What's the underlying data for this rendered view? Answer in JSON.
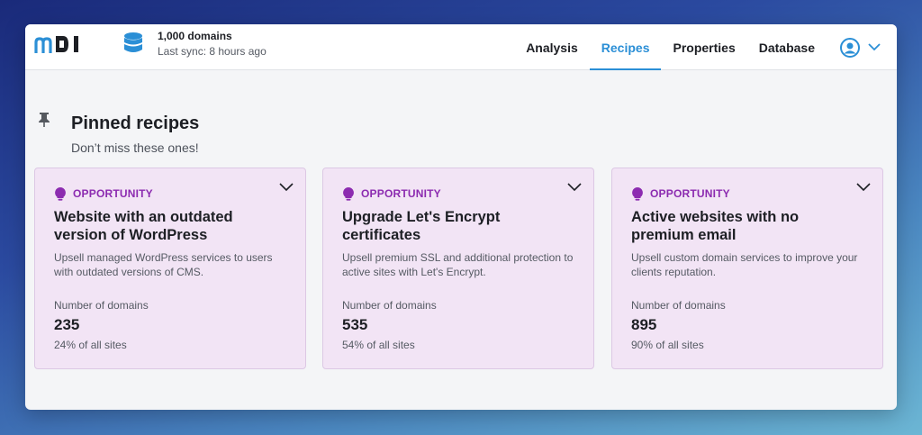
{
  "header": {
    "logo_text": "m01",
    "sync_title": "1,000 domains",
    "sync_subtitle": "Last sync: 8 hours ago",
    "nav": [
      {
        "label": "Analysis",
        "active": false
      },
      {
        "label": "Recipes",
        "active": true
      },
      {
        "label": "Properties",
        "active": false
      },
      {
        "label": "Database",
        "active": false
      }
    ],
    "accent_color": "#2b8fd6"
  },
  "pinned": {
    "title": "Pinned recipes",
    "subtitle": "Don’t miss these ones!"
  },
  "cards": [
    {
      "tag": "OPPORTUNITY",
      "title": "Website with an outdated version of WordPress",
      "description": "Upsell managed WordPress services to users with outdated versions of CMS.",
      "metric_label": "Number of domains",
      "metric_value": "235",
      "metric_percent": "24% of all sites"
    },
    {
      "tag": "OPPORTUNITY",
      "title": "Upgrade Let's Encrypt certificates",
      "description": "Upsell premium SSL and additional protection to active sites with Let's Encrypt.",
      "metric_label": "Number of domains",
      "metric_value": "535",
      "metric_percent": "54% of all sites"
    },
    {
      "tag": "OPPORTUNITY",
      "title": "Active websites with no premium email",
      "description": "Upsell custom domain services to improve your clients reputation.",
      "metric_label": "Number of domains",
      "metric_value": "895",
      "metric_percent": "90% of all sites"
    }
  ],
  "icons": {
    "logo": "m01-logo",
    "sync": "database-icon",
    "user": "user-circle-icon",
    "pin": "pin-icon",
    "tag": "lightbulb-icon",
    "expand": "chevron-down-icon"
  },
  "colors": {
    "card_bg": "#f2e4f5",
    "tag_color": "#8c2bb0"
  }
}
